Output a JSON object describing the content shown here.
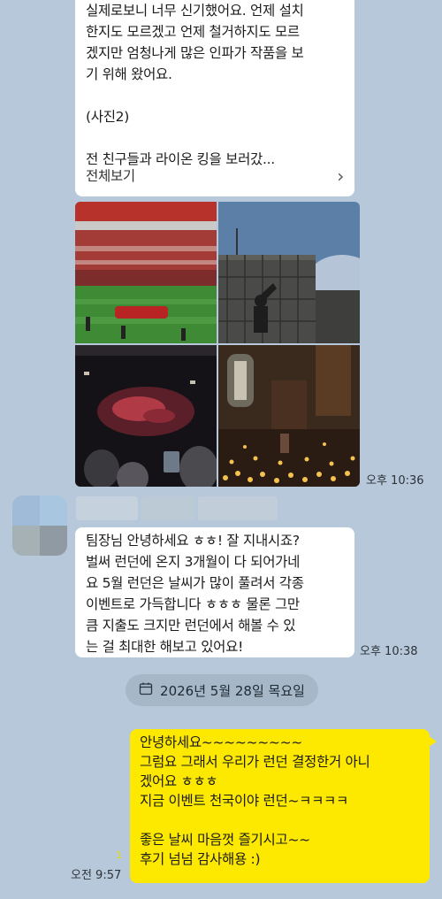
{
  "msg_prev": {
    "lines": [
      "실제로보니 너무 신기했어요. 언제 설치",
      "한지도 모르겠고 언제 철거하지도 모르",
      "겠지만 엄청나게 많은 인파가 작품을 보",
      "기 위해 왔어요.",
      "",
      "(사진2)",
      "",
      "전 친구들과 라이온 킹을 보러갔..."
    ],
    "more_label": "전체보기",
    "more_icon": "chevron-right-icon"
  },
  "photos": {
    "items": [
      "stadium-photo",
      "building-statue-photo",
      "theater-stage-photo",
      "candlelit-church-photo"
    ],
    "time": "오후 10:36"
  },
  "msg_reply": {
    "lines": [
      "팀장님 안녕하세요 ㅎㅎ! 잘 지내시죠?",
      "벌써 런던에 온지 3개월이 다 되어가네",
      "요 5월 런던은 날씨가 많이 풀려서 각종",
      "이벤트로 가득합니다 ㅎㅎㅎ 물론 그만",
      "큼 지출도 크지만 런던에서 해볼 수 있",
      "는 걸 최대한 해보고 있어요!"
    ],
    "time": "오후 10:38"
  },
  "date_divider": {
    "icon": "calendar-icon",
    "text": "2026년 5월 28일 목요일"
  },
  "my_msg": {
    "lines": [
      "안녕하세요~~~~~~~~~",
      "그럼요 그래서 우리가 런던 결정한거 아니",
      "겠어요 ㅎㅎㅎ",
      "지금 이벤트 천국이야 런던~ㅋㅋㅋㅋ",
      "",
      "좋은 날씨 마음껏 즐기시고~~",
      "후기 넘넘 감사해용 :)"
    ],
    "unread": "1",
    "time": "오전 9:57"
  },
  "colors": {
    "background": "#b6c8da",
    "bubble_white": "#ffffff",
    "bubble_yellow": "#fde800",
    "date_pill": "#a6b7c8"
  }
}
